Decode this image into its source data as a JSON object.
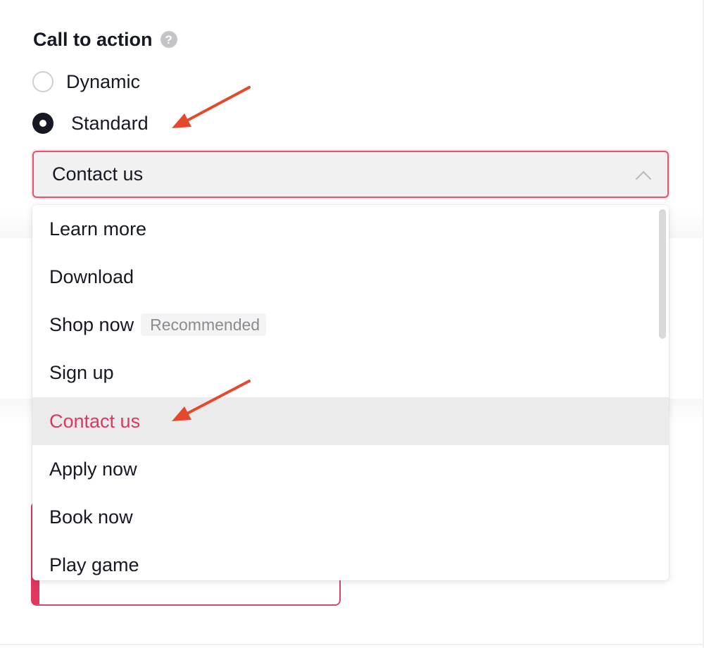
{
  "section": {
    "title": "Call to action",
    "help_icon": "?"
  },
  "radios": [
    {
      "label": "Dynamic",
      "checked": false
    },
    {
      "label": "Standard",
      "checked": true
    }
  ],
  "select": {
    "value": "Contact us",
    "expanded": true,
    "options": [
      {
        "label": "Learn more"
      },
      {
        "label": "Download"
      },
      {
        "label": "Shop now",
        "badge": "Recommended"
      },
      {
        "label": "Sign up"
      },
      {
        "label": "Contact us",
        "selected": true
      },
      {
        "label": "Apply now"
      },
      {
        "label": "Book now"
      },
      {
        "label": "Play game"
      }
    ]
  },
  "colors": {
    "accent": "#e0375f",
    "annotation_arrow": "#e5492d",
    "text": "#161823",
    "selected_row_bg": "#ebebec"
  },
  "icons": {
    "help": "help-circle-icon",
    "select_chevron": "chevron-up-icon",
    "radio_checked": "radio-checked-icon",
    "radio_unchecked": "radio-unchecked-icon"
  }
}
